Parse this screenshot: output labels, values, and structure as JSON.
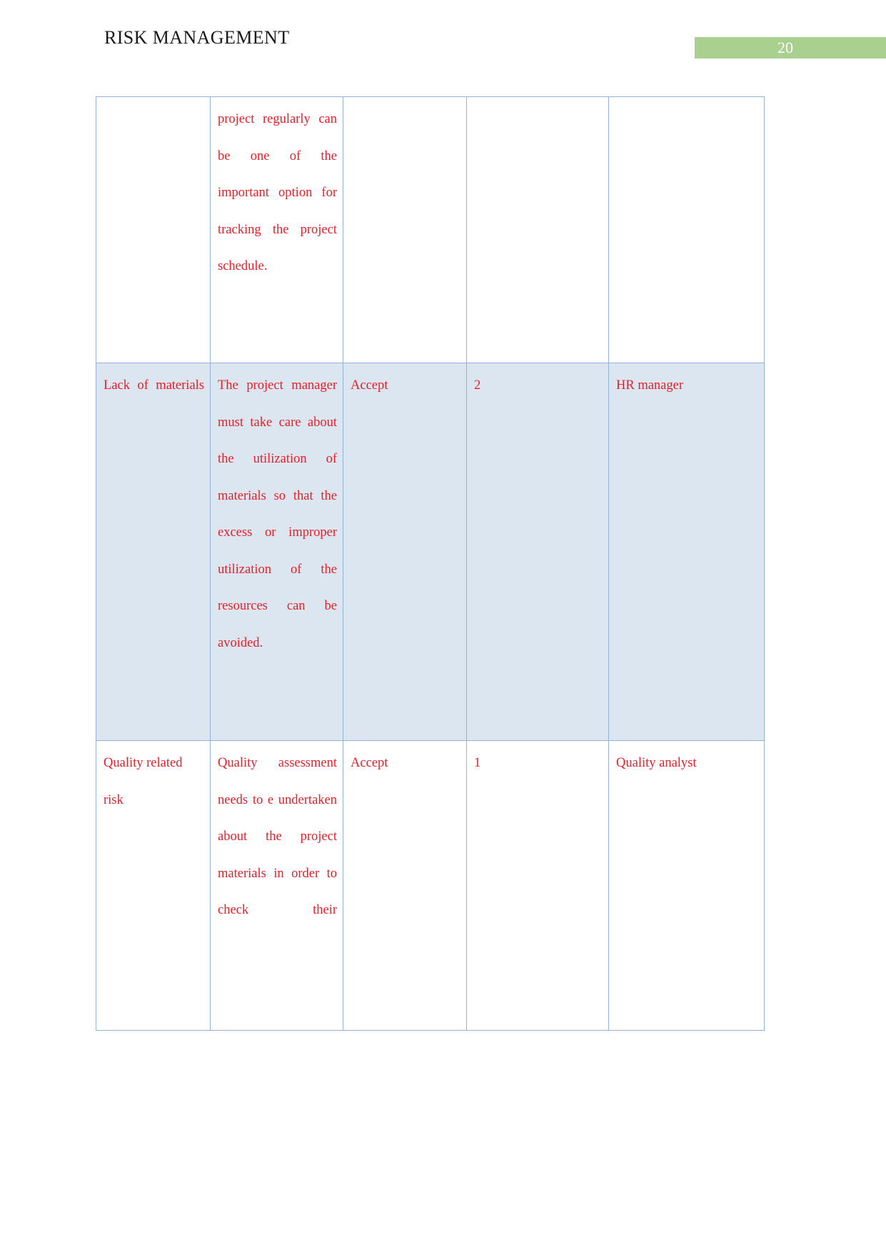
{
  "header": {
    "title": "RISK MANAGEMENT",
    "page_number": "20",
    "page_number_bar_color": "#a9d08e"
  },
  "theme": {
    "text_color": "#ee1c25",
    "border_color": "#95b3d7",
    "shaded_row_color": "#dce6f1",
    "plain_row_color": "#ffffff",
    "header_text_color": "#1a1a1a"
  },
  "table": {
    "columns": [
      "risk",
      "mitigation_strategy",
      "response",
      "priority",
      "owner"
    ],
    "rows": [
      {
        "shaded": false,
        "risk": "",
        "mitigation": "project regularly can be one of the important option for tracking the project schedule.",
        "response": "",
        "priority": "",
        "owner": ""
      },
      {
        "shaded": true,
        "risk": "Lack of materials",
        "mitigation": "The project manager must take care about the utilization of materials so that the excess or improper utilization of the resources can be avoided.",
        "response": "Accept",
        "priority": "2",
        "owner": "HR manager"
      },
      {
        "shaded": false,
        "risk": "Quality related risk",
        "mitigation": "Quality assessment needs to e undertaken about the project materials in order to check their",
        "response": "Accept",
        "priority": "1",
        "owner": "Quality analyst"
      }
    ]
  }
}
